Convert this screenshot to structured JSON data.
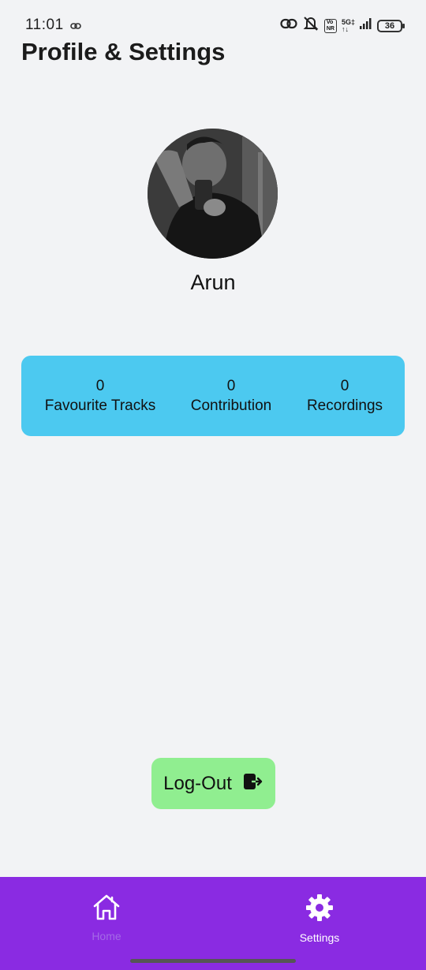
{
  "status_bar": {
    "time": "11:01",
    "network": "5G",
    "battery": "36",
    "icons": [
      "link-icon",
      "mute-icon",
      "volte-icon",
      "signal-icon",
      "battery-icon"
    ]
  },
  "page": {
    "title": "Profile & Settings"
  },
  "profile": {
    "name": "Arun",
    "avatar_icon": "profile-photo"
  },
  "stats": [
    {
      "value": "0",
      "label": "Favourite Tracks"
    },
    {
      "value": "0",
      "label": "Contribution"
    },
    {
      "value": "0",
      "label": "Recordings"
    }
  ],
  "logout": {
    "label": "Log-Out",
    "icon": "logout-icon"
  },
  "bottom_nav": {
    "items": [
      {
        "label": "Home",
        "icon": "home-icon",
        "active": false
      },
      {
        "label": "Settings",
        "icon": "gear-icon",
        "active": true
      }
    ]
  },
  "colors": {
    "background": "#f2f3f5",
    "stats_card": "#4cc9f0",
    "logout_button": "#90ee90",
    "nav_bar": "#8a2be2",
    "nav_inactive": "#a46ae6",
    "nav_active": "#ffffff"
  }
}
